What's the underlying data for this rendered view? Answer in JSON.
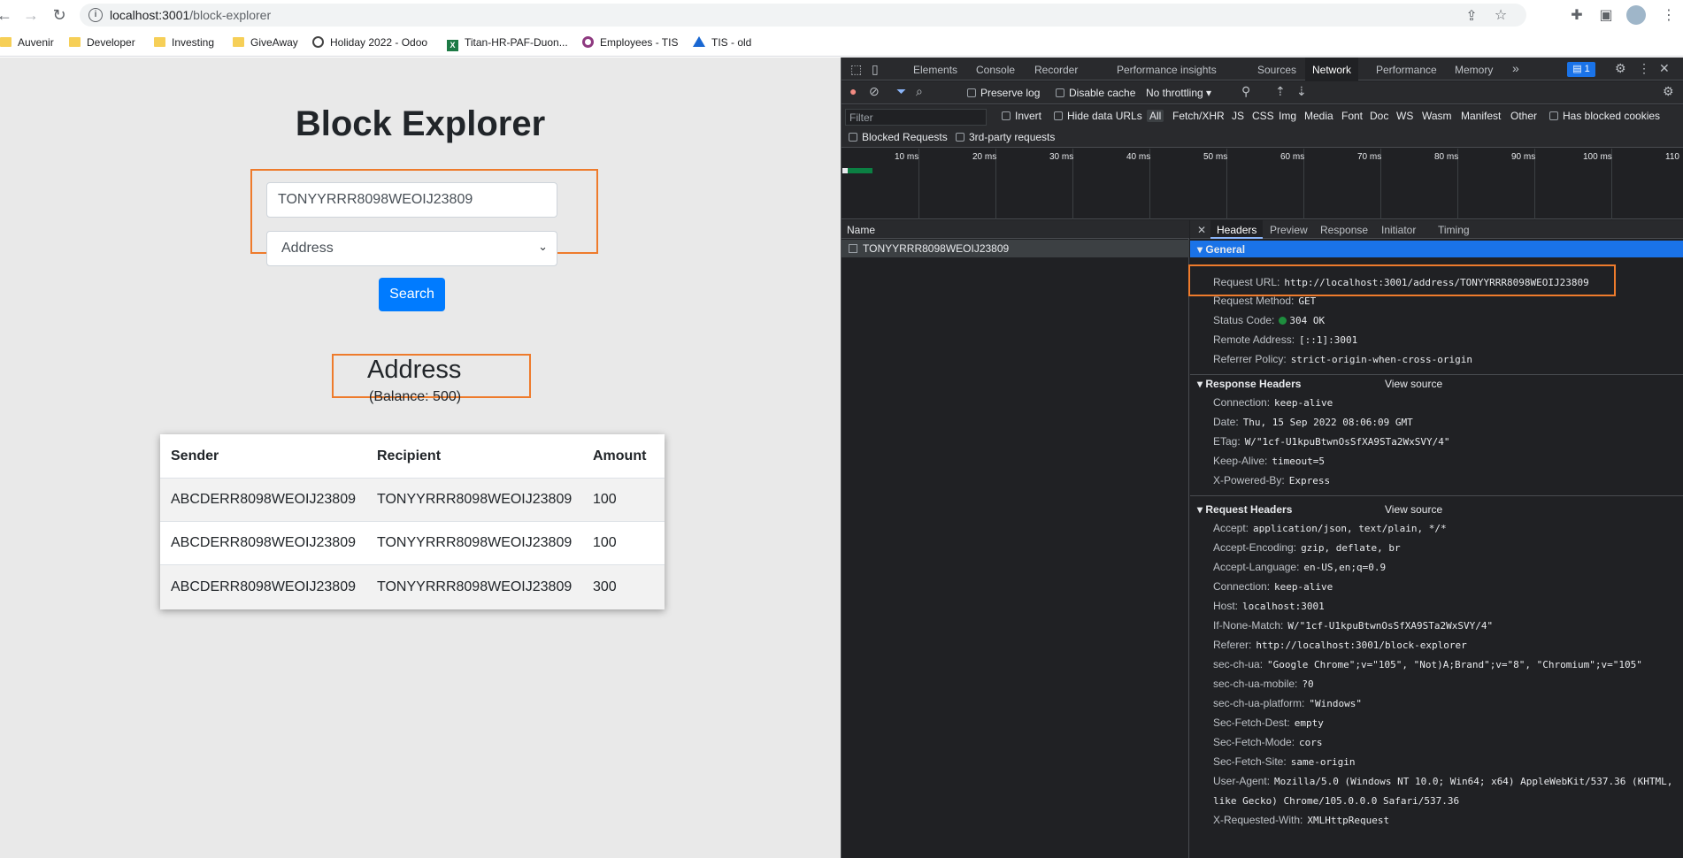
{
  "browser": {
    "url_host": "localhost:3001",
    "url_path": "/block-explorer",
    "bookmarks": [
      "Auvenir",
      "Developer",
      "Investing",
      "GiveAway",
      "Holiday 2022 - Odoo",
      "Titan-HR-PAF-Duon...",
      "Employees - TIS",
      "TIS - old"
    ]
  },
  "page": {
    "title": "Block Explorer",
    "search_value": "TONYYRRR8098WEOIJ23809",
    "type_selected": "Address",
    "search_label": "Search",
    "address_heading": "Address",
    "balance": "(Balance: 500)",
    "table": {
      "headers": [
        "Sender",
        "Recipient",
        "Amount"
      ],
      "rows": [
        [
          "ABCDERR8098WEOIJ23809",
          "TONYYRRR8098WEOIJ23809",
          "100"
        ],
        [
          "ABCDERR8098WEOIJ23809",
          "TONYYRRR8098WEOIJ23809",
          "100"
        ],
        [
          "ABCDERR8098WEOIJ23809",
          "TONYYRRR8098WEOIJ23809",
          "300"
        ]
      ]
    },
    "highlight_color": "#ee7b2c"
  },
  "devtools": {
    "tabs": [
      "Elements",
      "Console",
      "Recorder",
      "Performance insights",
      "Sources",
      "Network",
      "Performance",
      "Memory"
    ],
    "active_tab": "Network",
    "badge": "1",
    "toolbar": {
      "preserve_log": "Preserve log",
      "disable_cache": "Disable cache",
      "throttling": "No throttling"
    },
    "filter": {
      "placeholder": "Filter",
      "invert": "Invert",
      "hide_data_urls": "Hide data URLs",
      "types": [
        "All",
        "Fetch/XHR",
        "JS",
        "CSS",
        "Img",
        "Media",
        "Font",
        "Doc",
        "WS",
        "Wasm",
        "Manifest",
        "Other"
      ],
      "has_blocked": "Has blocked cookies",
      "blocked_requests": "Blocked Requests",
      "third_party": "3rd-party requests"
    },
    "timeline_ticks": [
      "10 ms",
      "20 ms",
      "30 ms",
      "40 ms",
      "50 ms",
      "60 ms",
      "70 ms",
      "80 ms",
      "90 ms",
      "100 ms",
      "110"
    ],
    "name_header": "Name",
    "request_name": "TONYYRRR8098WEOIJ23809",
    "detail_tabs": [
      "Headers",
      "Preview",
      "Response",
      "Initiator",
      "Timing"
    ],
    "general": {
      "title": "General",
      "items": [
        {
          "k": "Request URL:",
          "v": "http://localhost:3001/address/TONYYRRR8098WEOIJ23809"
        },
        {
          "k": "Request Method:",
          "v": "GET"
        },
        {
          "k": "Status Code:",
          "v": "304 OK"
        },
        {
          "k": "Remote Address:",
          "v": "[::1]:3001"
        },
        {
          "k": "Referrer Policy:",
          "v": "strict-origin-when-cross-origin"
        }
      ]
    },
    "response_headers": {
      "title": "Response Headers",
      "view_source": "View source",
      "items": [
        {
          "k": "Connection:",
          "v": "keep-alive"
        },
        {
          "k": "Date:",
          "v": "Thu, 15 Sep 2022 08:06:09 GMT"
        },
        {
          "k": "ETag:",
          "v": "W/\"1cf-U1kpuBtwnOsSfXA9STa2WxSVY/4\""
        },
        {
          "k": "Keep-Alive:",
          "v": "timeout=5"
        },
        {
          "k": "X-Powered-By:",
          "v": "Express"
        }
      ]
    },
    "request_headers": {
      "title": "Request Headers",
      "view_source": "View source",
      "items": [
        {
          "k": "Accept:",
          "v": "application/json, text/plain, */*"
        },
        {
          "k": "Accept-Encoding:",
          "v": "gzip, deflate, br"
        },
        {
          "k": "Accept-Language:",
          "v": "en-US,en;q=0.9"
        },
        {
          "k": "Connection:",
          "v": "keep-alive"
        },
        {
          "k": "Host:",
          "v": "localhost:3001"
        },
        {
          "k": "If-None-Match:",
          "v": "W/\"1cf-U1kpuBtwnOsSfXA9STa2WxSVY/4\""
        },
        {
          "k": "Referer:",
          "v": "http://localhost:3001/block-explorer"
        },
        {
          "k": "sec-ch-ua:",
          "v": "\"Google Chrome\";v=\"105\", \"Not)A;Brand\";v=\"8\", \"Chromium\";v=\"105\""
        },
        {
          "k": "sec-ch-ua-mobile:",
          "v": "?0"
        },
        {
          "k": "sec-ch-ua-platform:",
          "v": "\"Windows\""
        },
        {
          "k": "Sec-Fetch-Dest:",
          "v": "empty"
        },
        {
          "k": "Sec-Fetch-Mode:",
          "v": "cors"
        },
        {
          "k": "Sec-Fetch-Site:",
          "v": "same-origin"
        },
        {
          "k": "User-Agent:",
          "v": "Mozilla/5.0 (Windows NT 10.0; Win64; x64) AppleWebKit/537.36 (KHTML,"
        },
        {
          "k": "",
          "v": "like Gecko) Chrome/105.0.0.0 Safari/537.36"
        },
        {
          "k": "X-Requested-With:",
          "v": "XMLHttpRequest"
        }
      ]
    }
  }
}
